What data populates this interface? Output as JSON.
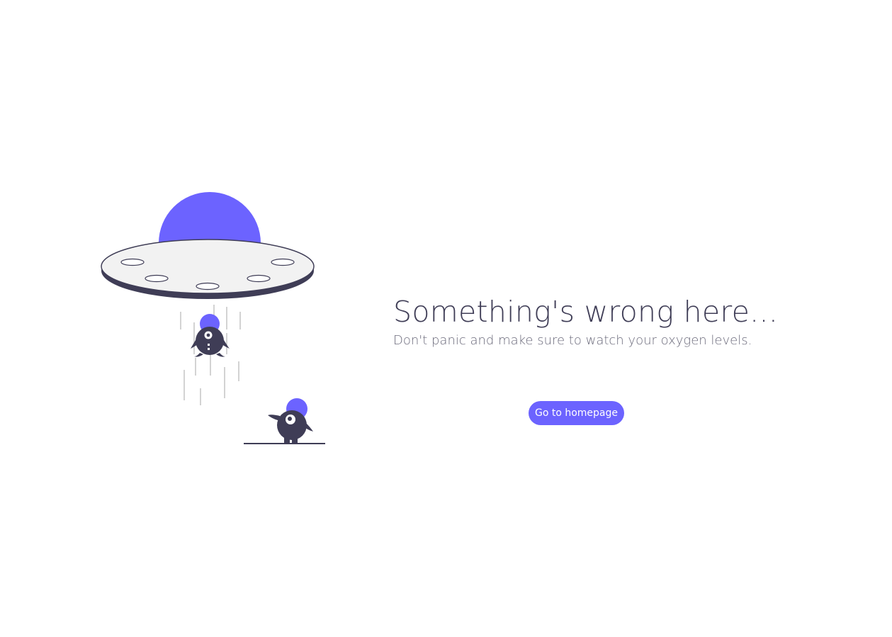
{
  "error": {
    "title": "Something's wrong here...",
    "message": "Don't panic and make sure to watch your oxygen levels.",
    "home_button_label": "Go to homepage"
  },
  "illustration": {
    "icon": "ufo-abduction-illustration"
  },
  "colors": {
    "accent": "#6c63ff",
    "dark": "#3f3d56",
    "text": "#3f3d56",
    "background": "#ffffff"
  }
}
